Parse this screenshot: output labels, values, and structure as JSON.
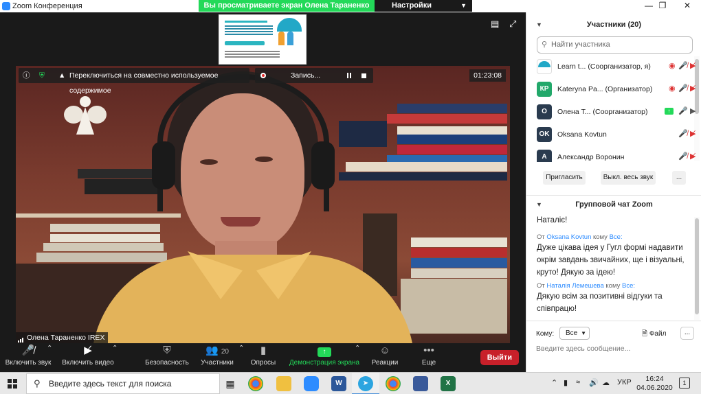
{
  "window": {
    "title": "Zoom Конференция",
    "share_banner": "Вы просматриваете экран  Олена Тараненко IREX",
    "view_options": "Настройки просмотра",
    "minimize": "—",
    "maximize": "❐",
    "close": "✕"
  },
  "video": {
    "switch_content": "Переключиться на совместно используемое содержимое",
    "recording": "Запись...",
    "timer": "01:23:08",
    "speaker_name": "Олена Тараненко IREX"
  },
  "toolbar": {
    "mic": "Включить звук",
    "video": "Включить видео",
    "security": "Безопасность",
    "participants": "Участники",
    "participants_count": "20",
    "polls": "Опросы",
    "share_screen": "Демонстрация экрана",
    "reactions": "Реакции",
    "more": "Еще",
    "leave": "Выйти"
  },
  "participants_panel": {
    "title": "Участники (20)",
    "search_placeholder": "Найти участника",
    "participants": [
      {
        "initials": "",
        "name": "Learn t...  (Соорганизатор, я)",
        "avatar_color": "#ffffff"
      },
      {
        "initials": "КР",
        "name": "Kateryna Pa...  (Организатор)",
        "avatar_color": "#22a86a"
      },
      {
        "initials": "О",
        "name": "Олена Т...  (Соорганизатор)",
        "avatar_color": "#2a3b4f"
      },
      {
        "initials": "OK",
        "name": "Oksana Kovtun",
        "avatar_color": "#2a3b4f"
      },
      {
        "initials": "А",
        "name": "Александр Воронин",
        "avatar_color": "#2a3b4f"
      }
    ],
    "invite": "Пригласить",
    "mute_all": "Выкл. весь звук",
    "more": "..."
  },
  "chat": {
    "title": "Групповой чат Zoom",
    "messages": [
      {
        "text": "Наталіє!"
      },
      {
        "meta_from": "От",
        "sender": "Oksana Kovtun",
        "meta_to": "кому",
        "recipient": "Все:",
        "text": "Дуже цікава ідея у Гугл формі надавити окрім завдань звичайних, ще і візуальні, круто! Дякую за ідею!"
      },
      {
        "meta_from": "От",
        "sender": "Наталія Лемешева",
        "meta_to": "кому",
        "recipient": "Все:",
        "text": "Дякую всім за позитивні відгуки та співпрацю!"
      }
    ],
    "to_label": "Кому:",
    "to_value": "Все",
    "file": "Файл",
    "more": "...",
    "input_placeholder": "Введите здесь сообщение..."
  },
  "taskbar": {
    "search_placeholder": "Введите здесь текст для поиска",
    "lang": "УКР",
    "time": "16:24",
    "date": "04.06.2020",
    "notifications": "1"
  },
  "colors": {
    "share_green": "#23d959",
    "leave_red": "#c8202a",
    "zoom_blue": "#2d8cff"
  }
}
